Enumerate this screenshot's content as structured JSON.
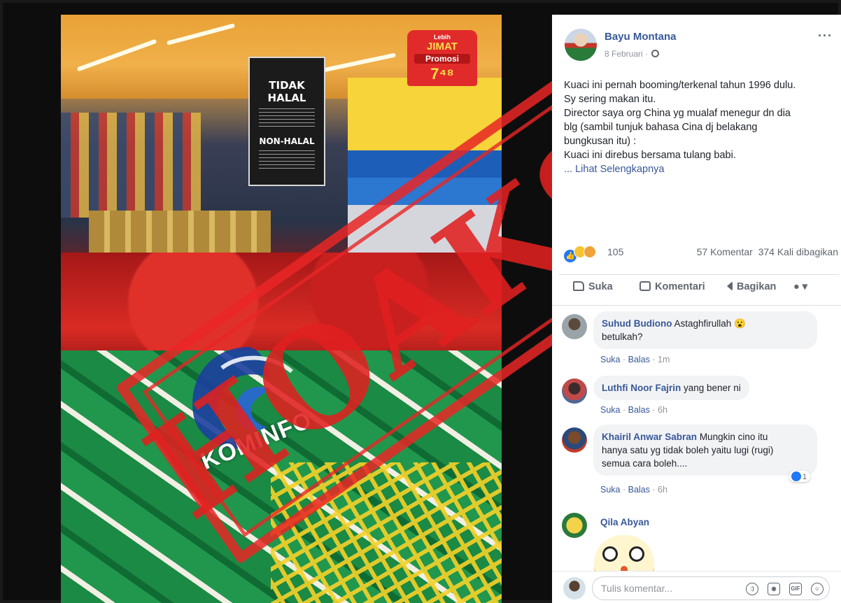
{
  "photo": {
    "sign_tidak_halal": "TIDAK HALAL",
    "sign_non_halal": "NON-HALAL",
    "promo_small": "Lebih",
    "promo_jimat": "JIMAT",
    "promo_label": "Promosi",
    "promo_price": "7⁴⁸",
    "watermark_brand": "KOMINFO",
    "stamp_text": "HOAKS"
  },
  "post": {
    "author": "Bayu Montana",
    "date": "8 Februari ·",
    "body_lines": [
      "Kuaci ini pernah booming/terkenal tahun 1996 dulu.",
      "Sy sering makan itu.",
      "Director saya org China yg mualaf menegur dn dia",
      "blg (sambil tunjuk bahasa Cina dj belakang",
      "bungkusan itu) :",
      "Kuaci ini direbus bersama tulang babi."
    ],
    "see_more": "... Lihat Selengkapnya",
    "reaction_count": "105",
    "comment_count": "57 Komentar",
    "share_count": "374 Kali dibagikan"
  },
  "actions": {
    "like": "Suka",
    "comment": "Komentari",
    "share": "Bagikan"
  },
  "comments": [
    {
      "name": "Suhud Budiono",
      "text": "Astaghfirullah 😮",
      "text2": "betulkah?",
      "like": "Suka",
      "reply": "Balas",
      "time": "1m"
    },
    {
      "name": "Luthfi Noor Fajrin",
      "text": "yang bener ni",
      "like": "Suka",
      "reply": "Balas",
      "time": "6h"
    },
    {
      "name": "Khairil Anwar Sabran",
      "text": "Mungkin cino itu",
      "text2": "hanya satu yg tidak boleh yaitu lugi (rugi)",
      "text3": "semua cara boleh....",
      "like": "Suka",
      "reply": "Balas",
      "time": "6h",
      "likes": "1"
    },
    {
      "name": "Qila Abyan"
    }
  ],
  "composer": {
    "placeholder": "Tulis komentar..."
  },
  "colors": {
    "fb_link": "#385898",
    "stamp_red": "#e02020",
    "like_blue": "#2078f4"
  }
}
